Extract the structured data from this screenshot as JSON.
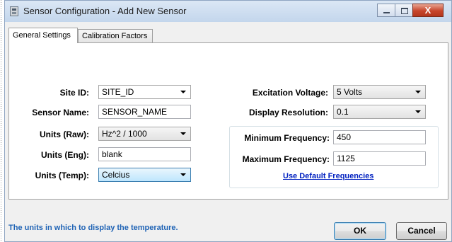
{
  "window": {
    "title": "Sensor Configuration - Add New Sensor",
    "close_glyph": "X"
  },
  "tabs": [
    {
      "label": "General Settings",
      "active": true
    },
    {
      "label": "Calibration Factors",
      "active": false
    }
  ],
  "fields": {
    "site_id": {
      "label": "Site ID:",
      "value": "SITE_ID"
    },
    "sensor_name": {
      "label": "Sensor Name:",
      "value": "SENSOR_NAME"
    },
    "units_raw": {
      "label": "Units (Raw):",
      "value": "Hz^2 / 1000"
    },
    "units_eng": {
      "label": "Units (Eng):",
      "value": "blank"
    },
    "units_temp": {
      "label": "Units (Temp):",
      "value": "Celcius"
    },
    "excitation_voltage": {
      "label": "Excitation Voltage:",
      "value": "5 Volts"
    },
    "display_resolution": {
      "label": "Display Resolution:",
      "value": "0.1"
    },
    "min_frequency": {
      "label": "Minimum Frequency:",
      "value": "450"
    },
    "max_frequency": {
      "label": "Maximum Frequency:",
      "value": "1125"
    }
  },
  "links": {
    "default_frequencies": "Use Default Frequencies"
  },
  "status_text": "The units in which to display the temperature.",
  "buttons": {
    "ok": "OK",
    "cancel": "Cancel"
  },
  "colors": {
    "status_text": "#1f63b5",
    "link": "#0020c0",
    "close_button": "#c7452b"
  }
}
